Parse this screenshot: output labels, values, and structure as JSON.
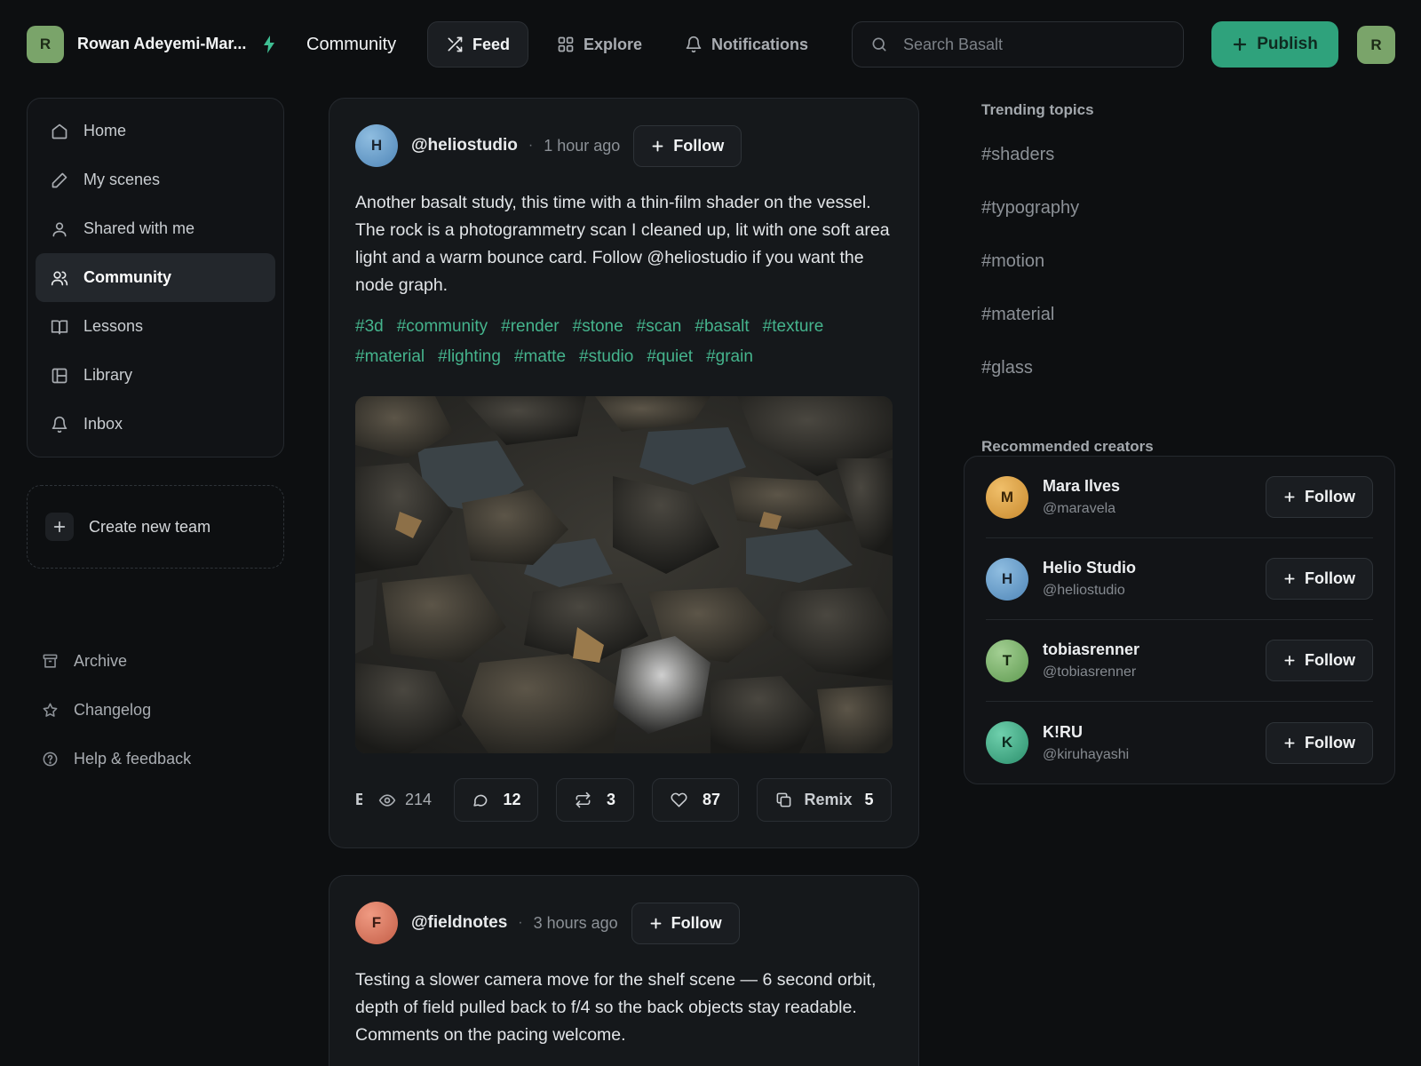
{
  "app": {
    "workspace_name": "Rowan Adeyemi-Mar...",
    "workspace_initial": "R",
    "section_title": "Community",
    "user_initial": "R"
  },
  "nav": {
    "tabs": [
      {
        "label": "Feed",
        "icon": "shuffle-icon",
        "active": true
      },
      {
        "label": "Explore",
        "icon": "grid-icon",
        "active": false
      },
      {
        "label": "Notifications",
        "icon": "bell-icon",
        "active": false
      }
    ],
    "search_placeholder": "Search Basalt",
    "publish_label": "Publish"
  },
  "sidebar": {
    "items": [
      {
        "label": "Home",
        "icon": "home-icon",
        "active": false
      },
      {
        "label": "My scenes",
        "icon": "pencil-icon",
        "active": false
      },
      {
        "label": "Shared with me",
        "icon": "user-icon",
        "active": false
      },
      {
        "label": "Community",
        "icon": "users-icon",
        "active": true
      },
      {
        "label": "Lessons",
        "icon": "book-icon",
        "active": false
      },
      {
        "label": "Library",
        "icon": "library-icon",
        "active": false
      },
      {
        "label": "Inbox",
        "icon": "bell-icon",
        "active": false
      }
    ],
    "create_team_label": "Create new team",
    "bottom_links": [
      {
        "label": "Archive",
        "icon": "archive-icon"
      },
      {
        "label": "Changelog",
        "icon": "star-icon"
      },
      {
        "label": "Help & feedback",
        "icon": "help-icon"
      }
    ]
  },
  "posts": [
    {
      "initial": "H",
      "handle": "@heliostudio",
      "time": "1 hour ago",
      "follow_label": "Follow",
      "body": "Another basalt study, this time with a thin-film shader on the vessel. The rock is a photogrammetry scan I cleaned up, lit with one soft area light and a warm bounce card. Follow @heliostudio if you want the node graph.",
      "tags": [
        "#3d",
        "#community",
        "#render",
        "#stone",
        "#scan",
        "#basalt",
        "#texture",
        "#material",
        "#lighting",
        "#matte",
        "#studio",
        "#quiet",
        "#grain"
      ],
      "truncated_label": "E",
      "views": "214",
      "comments": "12",
      "reposts": "3",
      "likes": "87",
      "remix_label": "Remix",
      "remixes": "5"
    },
    {
      "initial": "F",
      "handle": "@fieldnotes",
      "time": "3 hours ago",
      "follow_label": "Follow",
      "body": "Testing a slower camera move for the shelf scene — 6 second orbit, depth of field pulled back to f/4 so the back objects stay readable. Comments on the pacing welcome."
    }
  ],
  "right": {
    "trending_title": "Trending topics",
    "topics": [
      "#shaders",
      "#typography",
      "#motion",
      "#material",
      "#glass"
    ],
    "recommended_title": "Recommended creators",
    "creators": [
      {
        "initial": "M",
        "name": "Mara Ilves",
        "handle": "@maravela",
        "follow_label": "Follow",
        "color": "#d9a24a"
      },
      {
        "initial": "H",
        "name": "Helio Studio",
        "handle": "@heliostudio",
        "follow_label": "Follow",
        "color": "#6a9fcb"
      },
      {
        "initial": "T",
        "name": "tobiasrenner",
        "handle": "@tobiasrenner",
        "follow_label": "Follow",
        "color": "#7fb070"
      },
      {
        "initial": "K",
        "name": "K!RU",
        "handle": "@kiruhayashi",
        "follow_label": "Follow",
        "color": "#3fae8a"
      }
    ]
  },
  "colors": {
    "accent": "#2fa27c",
    "tag": "#45b48d",
    "background": "#0d0f11",
    "avatar_helio": "#6a9fcb",
    "avatar_fieldnotes": "#d6735c"
  }
}
